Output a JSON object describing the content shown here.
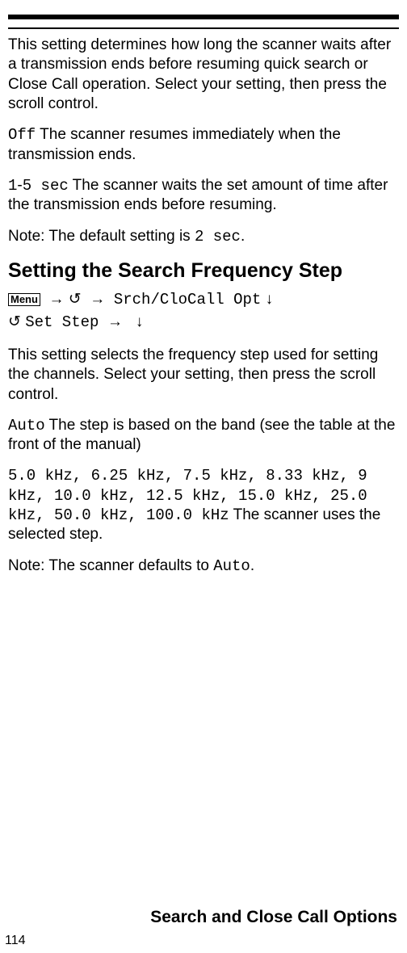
{
  "intro_para": "This setting determines how long the scanner waits after a transmission ends before resuming quick search or Close Call operation. Select your setting, then press the scroll control.",
  "off_code": "Off",
  "off_para": " The scanner resumes immediately when the transmission ends.",
  "range_code1": "1",
  "range_dash": "-",
  "range_code2": "5 sec",
  "range_para": " The scanner waits the set amount of time after the transmission ends before resuming.",
  "note1_prefix": "Note: The default setting is ",
  "note1_code": "2 sec",
  "note1_suffix": ".",
  "heading": "Setting the Search Frequency Step",
  "menu_label": "Menu",
  "arrow": "→",
  "scroll_icon": "↺",
  "nav_opt": "Srch/CloCall Opt",
  "down_arrow": "↓",
  "nav_setstep": "Set Step",
  "step_intro": "This setting selects the frequency step used for setting the channels. Select your setting, then press the scroll control.",
  "auto_code": "Auto",
  "auto_para": " The step is based on the band (see the table at the front of the manual)",
  "freq_list": "5.0 kHz, 6.25 kHz, 7.5 kHz, 8.33 kHz, 9 kHz, 10.0 kHz, 12.5 kHz, 15.0 kHz, 25.0 kHz, 50.0 kHz, 100.0 kHz",
  "freq_para": " The scanner uses the selected step.",
  "note2_prefix": "Note: The scanner defaults to ",
  "note2_code": "Auto",
  "note2_suffix": ".",
  "footer_title": "Search and Close Call Options",
  "page_number": "114"
}
